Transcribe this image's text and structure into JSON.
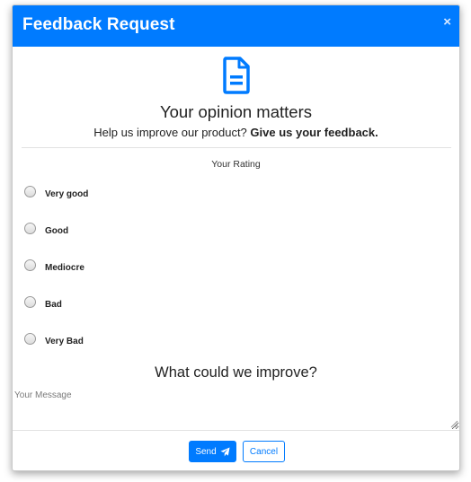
{
  "modal": {
    "title": "Feedback Request",
    "close_symbol": "×",
    "icon": "file-text-icon",
    "accent_color": "#007bff"
  },
  "intro": {
    "headline": "Your opinion matters",
    "subtext": "Help us improve our product?",
    "subtext_bold": "Give us your feedback."
  },
  "rating": {
    "label": "Your Rating",
    "options": [
      "Very good",
      "Good",
      "Mediocre",
      "Bad",
      "Very Bad"
    ],
    "selected": null
  },
  "improve": {
    "heading": "What could we improve?",
    "message_value": "",
    "message_placeholder": "Your Message"
  },
  "footer": {
    "send_label": "Send",
    "send_icon": "paper-plane-icon",
    "cancel_label": "Cancel"
  }
}
